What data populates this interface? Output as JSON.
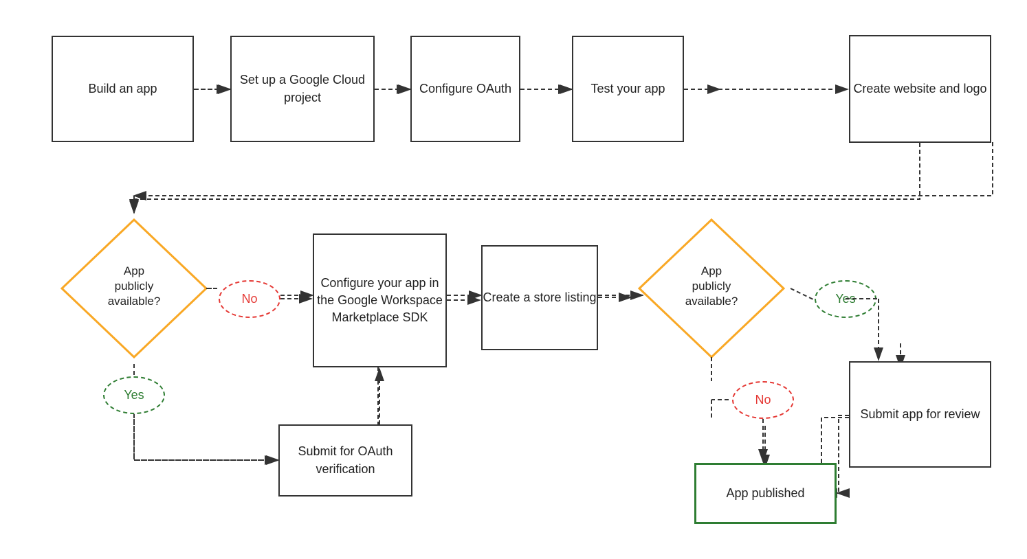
{
  "boxes": {
    "build_app": {
      "label": "Build\nan app"
    },
    "setup_google": {
      "label": "Set up a\nGoogle Cloud\nproject"
    },
    "configure_oauth": {
      "label": "Configure\nOAuth"
    },
    "test_app": {
      "label": "Test\nyour\napp"
    },
    "create_website": {
      "label": "Create\nwebsite\nand logo"
    },
    "configure_workspace": {
      "label": "Configure your\napp in the\nGoogle\nWorkspace\nMarketplace\nSDK"
    },
    "create_store": {
      "label": "Create a\nstore listing"
    },
    "submit_oauth": {
      "label": "Submit for\nOAuth\nverification"
    },
    "submit_review": {
      "label": "Submit app\nfor review"
    },
    "app_published": {
      "label": "App published"
    }
  },
  "diamonds": {
    "app_public_left": {
      "label": "App\npublicly\navailable?"
    },
    "app_public_right": {
      "label": "App\npublicly\navailable?"
    }
  },
  "ovals": {
    "no_left": {
      "label": "No"
    },
    "yes_left": {
      "label": "Yes"
    },
    "no_right": {
      "label": "No"
    },
    "yes_right": {
      "label": "Yes"
    }
  }
}
